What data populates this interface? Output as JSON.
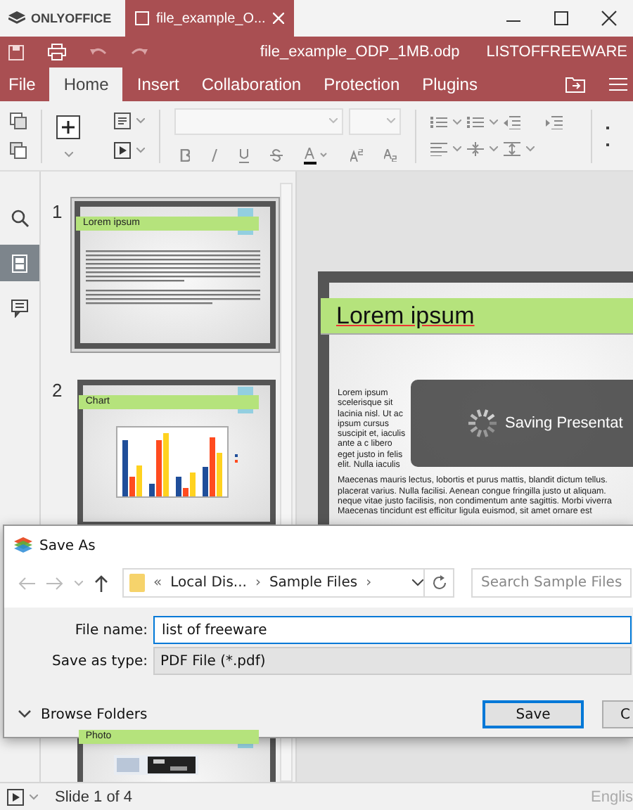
{
  "app": {
    "name": "ONLYOFFICE"
  },
  "document_tab": {
    "label": "file_example_O...",
    "selected": true
  },
  "header": {
    "file_name": "file_example_ODP_1MB.odp",
    "user": "LISTOFFREEWARE"
  },
  "menu_tabs": [
    {
      "label": "File",
      "selected": false
    },
    {
      "label": "Home",
      "selected": true
    },
    {
      "label": "Insert",
      "selected": false
    },
    {
      "label": "Collaboration",
      "selected": false
    },
    {
      "label": "Protection",
      "selected": false
    },
    {
      "label": "Plugins",
      "selected": false
    }
  ],
  "left_panel": [
    {
      "kind": "search",
      "selected": false
    },
    {
      "kind": "slides",
      "selected": true
    },
    {
      "kind": "comments",
      "selected": false
    }
  ],
  "thumbnails": [
    {
      "number": "1",
      "title": "Lorem ipsum",
      "kind": "text",
      "selected": true
    },
    {
      "number": "2",
      "title": "Chart",
      "kind": "chart",
      "selected": false
    },
    {
      "title": "Photo",
      "selected": false
    }
  ],
  "slide": {
    "title": "Lorem ipsum",
    "paragraphs": [
      [
        "Lorem ipsum",
        "scelerisque sit",
        "lacinia nisl. Ut ac",
        "ipsum cursus",
        "suscipit et, iaculis",
        "ante a c libero",
        "eget justo in felis",
        "elit. Nulla iaculis"
      ],
      [
        "Maecenas mauris lectus, lobortis et purus mattis, blandit dictum tellus.",
        "placerat varius. Nulla facilisi. Aenean congue fringilla justo ut aliquam.",
        "neque vitae justo facilisis, non condimentum ante sagittis. Morbi viverra",
        "Maecenas tincidunt est efficitur ligula euismod, sit amet ornare est"
      ]
    ]
  },
  "saving": {
    "message": "Saving Presentat"
  },
  "dialog": {
    "title": "Save As",
    "path": [
      {
        "kind": "overflow",
        "label": "«"
      },
      {
        "kind": "folder",
        "label": "Local Dis..."
      },
      {
        "kind": "separator",
        "label": "›"
      },
      {
        "kind": "folder",
        "label": "Sample Files"
      },
      {
        "kind": "separator",
        "label": "›"
      }
    ],
    "search": {
      "placeholder": "Search Sample Files"
    },
    "fields": [
      {
        "label": "File name:",
        "kind": "input",
        "value": "list of freeware"
      },
      {
        "label": "Save as type:",
        "kind": "select",
        "value": "PDF File (*.pdf)"
      }
    ],
    "browse": "Browse Folders",
    "buttons": [
      {
        "label": "Save",
        "selected": true
      },
      {
        "label": "C",
        "selected": false
      }
    ]
  },
  "status_bar": {
    "slide": "Slide 1 of 4",
    "language": "Englis"
  }
}
